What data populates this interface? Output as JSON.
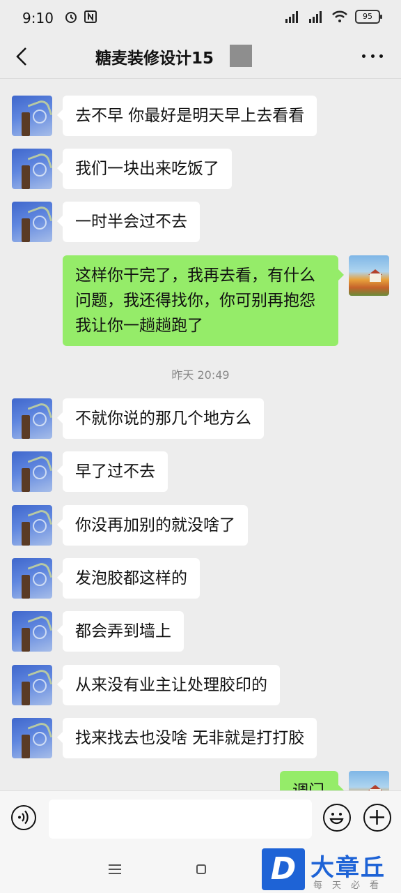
{
  "status_bar": {
    "time": "9:10",
    "battery": "95"
  },
  "header": {
    "title": "糖麦装修设计15",
    "back_icon": "chevron-left-icon",
    "more_icon": "more-dots-icon"
  },
  "messages": [
    {
      "side": "left",
      "text": "去不早 你最好是明天早上去看看"
    },
    {
      "side": "left",
      "text": "我们一块出来吃饭了"
    },
    {
      "side": "left",
      "text": "一时半会过不去"
    },
    {
      "side": "right",
      "text": "这样你干完了，我再去看，有什么问题，我还得找你，你可别再抱怨我让你一趟趟跑了"
    },
    {
      "side": "left",
      "text": "不就你说的那几个地方么"
    },
    {
      "side": "left",
      "text": "早了过不去"
    },
    {
      "side": "left",
      "text": "你没再加别的就没啥了"
    },
    {
      "side": "left",
      "text": "发泡胶都这样的"
    },
    {
      "side": "left",
      "text": "都会弄到墙上"
    },
    {
      "side": "left",
      "text": "从来没有业主让处理胶印的"
    },
    {
      "side": "left",
      "text": "找来找去也没啥 无非就是打打胶"
    },
    {
      "side": "right",
      "text": "调门"
    }
  ],
  "timestamp": "昨天 20:49",
  "input_bar": {
    "placeholder": "",
    "voice_icon": "voice-icon",
    "emoji_icon": "emoji-icon",
    "plus_icon": "plus-icon"
  },
  "watermark": {
    "logo": "D",
    "title": "大章丘",
    "subtitle": "每天必看"
  },
  "colors": {
    "background": "#ededed",
    "bubble_self": "#95ec69",
    "bubble_other": "#ffffff",
    "watermark_blue": "#1e63d6"
  }
}
